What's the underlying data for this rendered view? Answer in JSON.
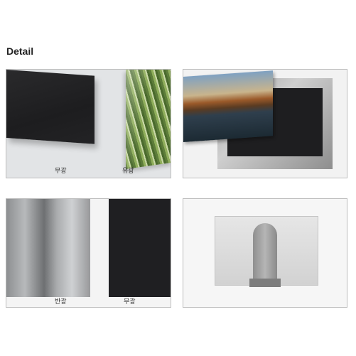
{
  "heading": "Detail",
  "panels": [
    {
      "labels": [
        "무광",
        "유광"
      ]
    },
    {
      "labels": []
    },
    {
      "labels": [
        "반광",
        "무광"
      ]
    },
    {
      "labels": []
    }
  ]
}
